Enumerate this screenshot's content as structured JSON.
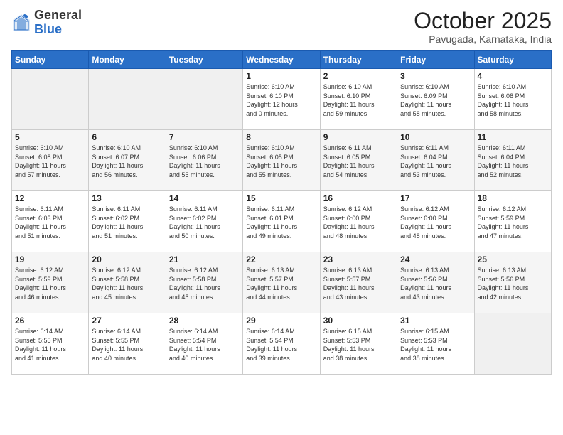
{
  "logo": {
    "general": "General",
    "blue": "Blue"
  },
  "header": {
    "month": "October 2025",
    "location": "Pavugada, Karnataka, India"
  },
  "weekdays": [
    "Sunday",
    "Monday",
    "Tuesday",
    "Wednesday",
    "Thursday",
    "Friday",
    "Saturday"
  ],
  "weeks": [
    [
      {
        "day": "",
        "info": ""
      },
      {
        "day": "",
        "info": ""
      },
      {
        "day": "",
        "info": ""
      },
      {
        "day": "1",
        "info": "Sunrise: 6:10 AM\nSunset: 6:10 PM\nDaylight: 12 hours\nand 0 minutes."
      },
      {
        "day": "2",
        "info": "Sunrise: 6:10 AM\nSunset: 6:10 PM\nDaylight: 11 hours\nand 59 minutes."
      },
      {
        "day": "3",
        "info": "Sunrise: 6:10 AM\nSunset: 6:09 PM\nDaylight: 11 hours\nand 58 minutes."
      },
      {
        "day": "4",
        "info": "Sunrise: 6:10 AM\nSunset: 6:08 PM\nDaylight: 11 hours\nand 58 minutes."
      }
    ],
    [
      {
        "day": "5",
        "info": "Sunrise: 6:10 AM\nSunset: 6:08 PM\nDaylight: 11 hours\nand 57 minutes."
      },
      {
        "day": "6",
        "info": "Sunrise: 6:10 AM\nSunset: 6:07 PM\nDaylight: 11 hours\nand 56 minutes."
      },
      {
        "day": "7",
        "info": "Sunrise: 6:10 AM\nSunset: 6:06 PM\nDaylight: 11 hours\nand 55 minutes."
      },
      {
        "day": "8",
        "info": "Sunrise: 6:10 AM\nSunset: 6:05 PM\nDaylight: 11 hours\nand 55 minutes."
      },
      {
        "day": "9",
        "info": "Sunrise: 6:11 AM\nSunset: 6:05 PM\nDaylight: 11 hours\nand 54 minutes."
      },
      {
        "day": "10",
        "info": "Sunrise: 6:11 AM\nSunset: 6:04 PM\nDaylight: 11 hours\nand 53 minutes."
      },
      {
        "day": "11",
        "info": "Sunrise: 6:11 AM\nSunset: 6:04 PM\nDaylight: 11 hours\nand 52 minutes."
      }
    ],
    [
      {
        "day": "12",
        "info": "Sunrise: 6:11 AM\nSunset: 6:03 PM\nDaylight: 11 hours\nand 51 minutes."
      },
      {
        "day": "13",
        "info": "Sunrise: 6:11 AM\nSunset: 6:02 PM\nDaylight: 11 hours\nand 51 minutes."
      },
      {
        "day": "14",
        "info": "Sunrise: 6:11 AM\nSunset: 6:02 PM\nDaylight: 11 hours\nand 50 minutes."
      },
      {
        "day": "15",
        "info": "Sunrise: 6:11 AM\nSunset: 6:01 PM\nDaylight: 11 hours\nand 49 minutes."
      },
      {
        "day": "16",
        "info": "Sunrise: 6:12 AM\nSunset: 6:00 PM\nDaylight: 11 hours\nand 48 minutes."
      },
      {
        "day": "17",
        "info": "Sunrise: 6:12 AM\nSunset: 6:00 PM\nDaylight: 11 hours\nand 48 minutes."
      },
      {
        "day": "18",
        "info": "Sunrise: 6:12 AM\nSunset: 5:59 PM\nDaylight: 11 hours\nand 47 minutes."
      }
    ],
    [
      {
        "day": "19",
        "info": "Sunrise: 6:12 AM\nSunset: 5:59 PM\nDaylight: 11 hours\nand 46 minutes."
      },
      {
        "day": "20",
        "info": "Sunrise: 6:12 AM\nSunset: 5:58 PM\nDaylight: 11 hours\nand 45 minutes."
      },
      {
        "day": "21",
        "info": "Sunrise: 6:12 AM\nSunset: 5:58 PM\nDaylight: 11 hours\nand 45 minutes."
      },
      {
        "day": "22",
        "info": "Sunrise: 6:13 AM\nSunset: 5:57 PM\nDaylight: 11 hours\nand 44 minutes."
      },
      {
        "day": "23",
        "info": "Sunrise: 6:13 AM\nSunset: 5:57 PM\nDaylight: 11 hours\nand 43 minutes."
      },
      {
        "day": "24",
        "info": "Sunrise: 6:13 AM\nSunset: 5:56 PM\nDaylight: 11 hours\nand 43 minutes."
      },
      {
        "day": "25",
        "info": "Sunrise: 6:13 AM\nSunset: 5:56 PM\nDaylight: 11 hours\nand 42 minutes."
      }
    ],
    [
      {
        "day": "26",
        "info": "Sunrise: 6:14 AM\nSunset: 5:55 PM\nDaylight: 11 hours\nand 41 minutes."
      },
      {
        "day": "27",
        "info": "Sunrise: 6:14 AM\nSunset: 5:55 PM\nDaylight: 11 hours\nand 40 minutes."
      },
      {
        "day": "28",
        "info": "Sunrise: 6:14 AM\nSunset: 5:54 PM\nDaylight: 11 hours\nand 40 minutes."
      },
      {
        "day": "29",
        "info": "Sunrise: 6:14 AM\nSunset: 5:54 PM\nDaylight: 11 hours\nand 39 minutes."
      },
      {
        "day": "30",
        "info": "Sunrise: 6:15 AM\nSunset: 5:53 PM\nDaylight: 11 hours\nand 38 minutes."
      },
      {
        "day": "31",
        "info": "Sunrise: 6:15 AM\nSunset: 5:53 PM\nDaylight: 11 hours\nand 38 minutes."
      },
      {
        "day": "",
        "info": ""
      }
    ]
  ]
}
